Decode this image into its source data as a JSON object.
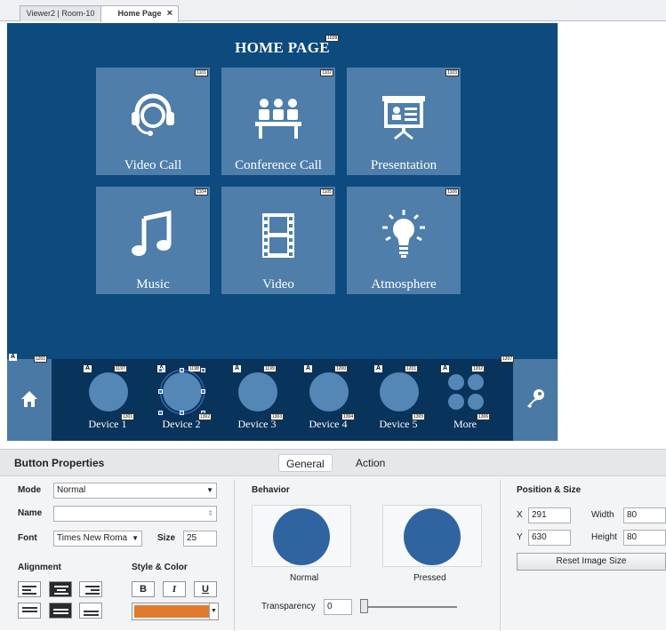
{
  "tabs": [
    {
      "label": "Viewer2 | Room-10"
    },
    {
      "label": "Home Page",
      "close": "×"
    }
  ],
  "canvas": {
    "title": "HOME PAGE",
    "title_id": "1028",
    "tiles": [
      {
        "label": "Video Call",
        "id": "1101",
        "icon": "headset-icon"
      },
      {
        "label": "Conference Call",
        "id": "1102",
        "icon": "meeting-icon"
      },
      {
        "label": "Presentation",
        "id": "1103",
        "icon": "projector-icon"
      },
      {
        "label": "Music",
        "id": "1104",
        "icon": "music-note-icon"
      },
      {
        "label": "Video",
        "id": "1105",
        "icon": "film-icon"
      },
      {
        "label": "Atmosphere",
        "id": "1106",
        "icon": "light-bulb-icon"
      }
    ],
    "home_id": "1201",
    "key_id": "1207",
    "devices": [
      {
        "label": "Device 1",
        "tag": "A",
        "id": "1197",
        "label_id": "1301"
      },
      {
        "label": "Device 2",
        "tag": "A",
        "id": "1198",
        "label_id": "1302"
      },
      {
        "label": "Device 3",
        "tag": "A",
        "id": "1199",
        "label_id": "1303"
      },
      {
        "label": "Device 4",
        "tag": "A",
        "id": "1200",
        "label_id": "1304"
      },
      {
        "label": "Device 5",
        "tag": "A",
        "id": "1201",
        "label_id": "1305"
      },
      {
        "label": "More",
        "tag": "A",
        "id": "1202",
        "label_id": "1306"
      }
    ],
    "home_tag": "A"
  },
  "panel": {
    "title": "Button Properties",
    "tabs": [
      "General",
      "Action"
    ],
    "mode_label": "Mode",
    "mode_value": "Normal",
    "name_label": "Name",
    "name_value": "",
    "font_label": "Font",
    "font_value": "Times New Roma",
    "size_label": "Size",
    "size_value": "25",
    "alignment_label": "Alignment",
    "style_label": "Style & Color",
    "bold": "B",
    "italic": "I",
    "underline": "U",
    "color": "#e07a2c",
    "behavior_label": "Behavior",
    "normal_label": "Normal",
    "pressed_label": "Pressed",
    "transparency_label": "Transparency",
    "transparency_value": "0",
    "transparency_level": 0,
    "pos_label": "Position & Size",
    "x_label": "X",
    "x_value": "291",
    "y_label": "Y",
    "y_value": "630",
    "width_label": "Width",
    "width_value": "80",
    "height_label": "Height",
    "height_value": "80",
    "reset_label": "Reset Image Size"
  }
}
